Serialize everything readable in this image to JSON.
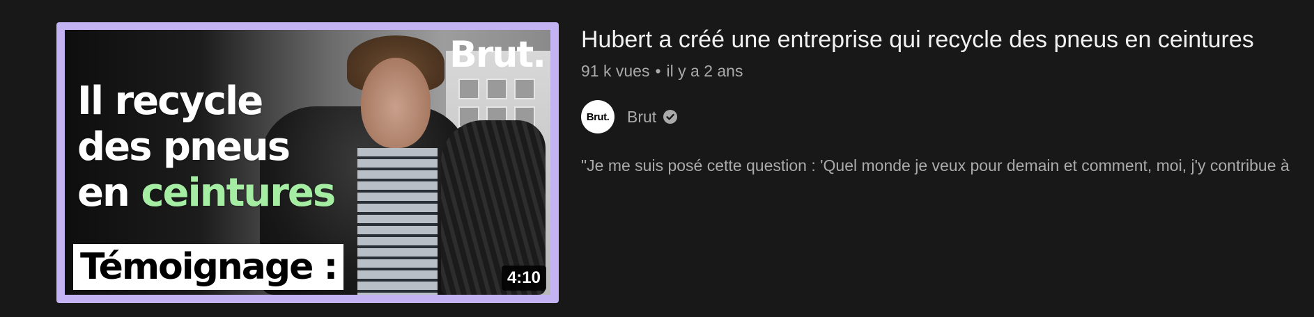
{
  "video": {
    "title": "Hubert a créé une entreprise qui recycle des pneus en ceintures",
    "views": "91 k vues",
    "separator": "•",
    "age": "il y a 2 ans",
    "duration": "4:10",
    "description": "\"Je me suis posé cette question : 'Quel monde je veux pour demain et comment, moi, j'y contribue à"
  },
  "channel": {
    "name": "Brut",
    "avatar_text": "Brut.",
    "verified_icon": "verified-check-icon"
  },
  "thumbnail": {
    "brand_logo": "Brut.",
    "headline_line1": "Il recycle",
    "headline_line2": "des pneus",
    "headline_line3_plain": "en ",
    "headline_line3_accent": "ceintures",
    "tag": "Témoignage :",
    "border_color": "#c4b3f3",
    "accent_color": "#a6eda4"
  },
  "colors": {
    "background": "#181818",
    "title_text": "#f1f1f1",
    "secondary_text": "#aaaaaa"
  }
}
